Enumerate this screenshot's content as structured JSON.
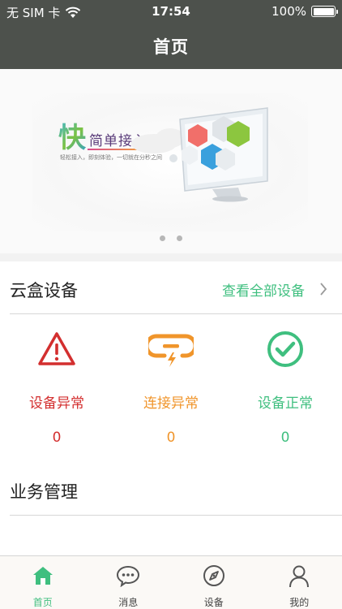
{
  "status_bar": {
    "carrier": "无 SIM 卡",
    "time": "17:54",
    "battery": "100%",
    "battery_level": 1.0
  },
  "nav": {
    "title": "首页"
  },
  "banner": {
    "headline_big": "快",
    "headline": "简单接入",
    "subline": "轻松接入，即刻体验，一切就在分秒之间",
    "slide_count": 2
  },
  "devices": {
    "title": "云盒设备",
    "view_all": "查看全部设备",
    "stats": [
      {
        "label": "设备异常",
        "count": "0",
        "icon": "warning-triangle-icon",
        "color": "#d32f2f"
      },
      {
        "label": "连接异常",
        "count": "0",
        "icon": "broken-link-icon",
        "color": "#f0952b"
      },
      {
        "label": "设备正常",
        "count": "0",
        "icon": "check-circle-icon",
        "color": "#3fbf7f"
      }
    ]
  },
  "business": {
    "title": "业务管理"
  },
  "tabbar": {
    "tabs": [
      {
        "label": "首页",
        "icon": "home-icon",
        "active": true
      },
      {
        "label": "消息",
        "icon": "message-icon",
        "active": false
      },
      {
        "label": "设备",
        "icon": "compass-icon",
        "active": false
      },
      {
        "label": "我的",
        "icon": "user-icon",
        "active": false
      }
    ]
  },
  "colors": {
    "header_bg": "#4d514c",
    "accent_green": "#3fbf7f",
    "alert_red": "#d32f2f",
    "warn_orange": "#f0952b"
  }
}
